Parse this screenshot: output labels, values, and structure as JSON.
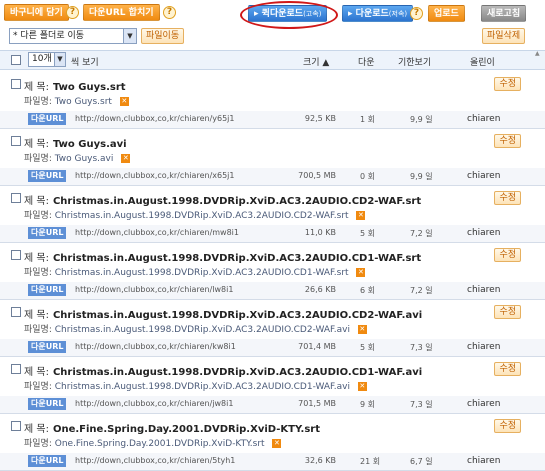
{
  "toolbar": {
    "basket_label": "바구니에 담기",
    "merge_url_label": "다운URL 합치기",
    "quick_download_label": "퀵다운로드",
    "quick_download_note": "(고속)",
    "download_label": "다운로드",
    "download_note": "(저속)",
    "upload_label": "업로드",
    "refresh_label": "새로고침",
    "help_glyph": "?"
  },
  "folder": {
    "move_select_value": "* 다른 폴더로 이동",
    "move_button_label": "파일이동",
    "delete_button_label": "파일삭제"
  },
  "list_header": {
    "page_size_value": "10개",
    "page_size_suffix": "씩 보기",
    "col_size": "크기 ▲",
    "col_downloads": "다운",
    "col_period": "기한보기",
    "col_uploader": "올린이"
  },
  "row_labels": {
    "title_label": "제 목:",
    "filename_label": "파일명:",
    "url_badge": "다운URL",
    "edit_label": "수정"
  },
  "items": [
    {
      "title": "Two Guys.srt",
      "filename": "Two Guys.srt",
      "url": "http://down,clubbox,co,kr/chiaren/y65j1",
      "size": "92,5 KB",
      "downloads": "1 회",
      "period": "9,9 일",
      "uploader": "chiaren"
    },
    {
      "title": "Two Guys.avi",
      "filename": "Two Guys.avi",
      "url": "http://down,clubbox,co,kr/chiaren/x65j1",
      "size": "700,5 MB",
      "downloads": "0 회",
      "period": "9,9 일",
      "uploader": "chiaren"
    },
    {
      "title": "Christmas.in.August.1998.DVDRip.XviD.AC3.2AUDIO.CD2-WAF.srt",
      "filename": "Christmas.in.August.1998.DVDRip.XviD.AC3.2AUDIO.CD2-WAF.srt",
      "url": "http://down,clubbox,co,kr/chiaren/mw8i1",
      "size": "11,0 KB",
      "downloads": "5 회",
      "period": "7,2 일",
      "uploader": "chiaren"
    },
    {
      "title": "Christmas.in.August.1998.DVDRip.XviD.AC3.2AUDIO.CD1-WAF.srt",
      "filename": "Christmas.in.August.1998.DVDRip.XviD.AC3.2AUDIO.CD1-WAF.srt",
      "url": "http://down,clubbox,co,kr/chiaren/lw8i1",
      "size": "26,6 KB",
      "downloads": "6 회",
      "period": "7,2 일",
      "uploader": "chiaren"
    },
    {
      "title": "Christmas.in.August.1998.DVDRip.XviD.AC3.2AUDIO.CD2-WAF.avi",
      "filename": "Christmas.in.August.1998.DVDRip.XviD.AC3.2AUDIO.CD2-WAF.avi",
      "url": "http://down,clubbox,co,kr/chiaren/kw8i1",
      "size": "701,4 MB",
      "downloads": "5 회",
      "period": "7,3 일",
      "uploader": "chiaren"
    },
    {
      "title": "Christmas.in.August.1998.DVDRip.XviD.AC3.2AUDIO.CD1-WAF.avi",
      "filename": "Christmas.in.August.1998.DVDRip.XviD.AC3.2AUDIO.CD1-WAF.avi",
      "url": "http://down,clubbox,co,kr/chiaren/jw8i1",
      "size": "701,5 MB",
      "downloads": "9 회",
      "period": "7,3 일",
      "uploader": "chiaren"
    },
    {
      "title": "One.Fine.Spring.Day.2001.DVDRip.XviD-KTY.srt",
      "filename": "One.Fine.Spring.Day.2001.DVDRip.XviD-KTY.srt",
      "url": "http://down,clubbox,co,kr/chiaren/5tyh1",
      "size": "32,6 KB",
      "downloads": "21 회",
      "period": "6,7 일",
      "uploader": "chiaren"
    }
  ],
  "colors": {
    "accent_orange": "#f08a10",
    "accent_blue": "#2c74cf",
    "highlight_circle": "#d01818"
  }
}
